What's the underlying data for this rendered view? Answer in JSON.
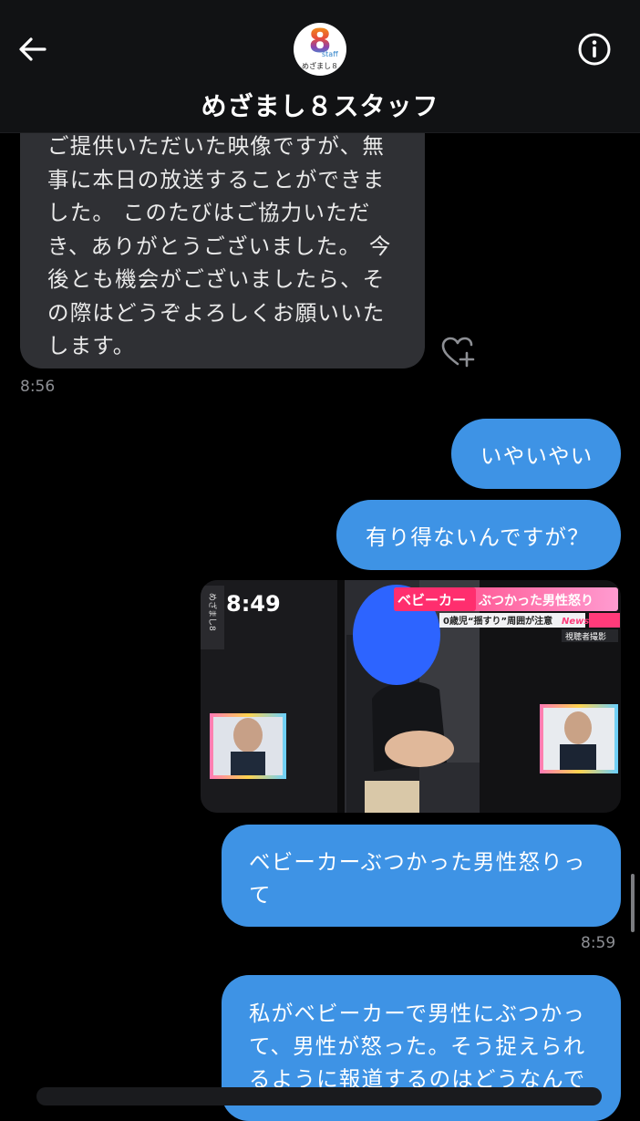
{
  "header": {
    "title": "めざまし８スタッフ",
    "avatar": {
      "numeral": "8",
      "staff": "staff",
      "subtitle": "めざまし８"
    },
    "icons": {
      "back": "back-arrow-icon",
      "info": "info-icon"
    }
  },
  "messages": {
    "incoming_text": "ご提供いただいた映像ですが、無事に本日の放送することができました。 このたびはご協力いただき、ありがとうございました。 今後とも機会がございましたら、その際はどうぞよろしくお願いいたします。",
    "incoming_time": "8:56",
    "out1": "いやいやい",
    "out2": "有り得ないんですが？",
    "photo": {
      "clock": "8:49",
      "banner_left": "ベビーカー",
      "banner_right": "ぶつかった男性怒り",
      "caption": "0歳児“揺すり”周囲が注意",
      "brand": "NewsTag",
      "label": "視聴者撮影",
      "logo": "めざまし8"
    },
    "out3": "ベビーカーぶつかった男性怒りって",
    "out3_time": "8:59",
    "out4": "私がベビーカーで男性にぶつかって、男性が怒った。そう捉えられるように報道するのはどうなんで"
  },
  "colors": {
    "background": "#000000",
    "header": "#111214",
    "incoming_bubble": "#2f3034",
    "outgoing_bubble": "#3e93e5",
    "timestamp": "#8d8f94"
  }
}
